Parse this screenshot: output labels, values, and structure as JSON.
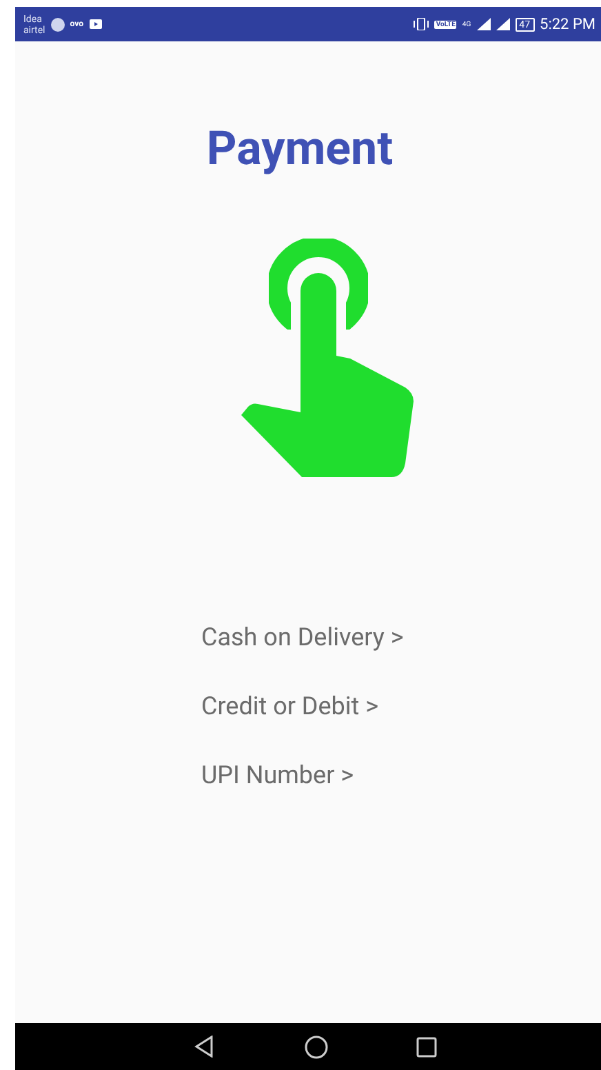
{
  "status_bar": {
    "carrier": [
      "Idea",
      "airtel"
    ],
    "app_label": "ovo",
    "network_badge": "VoLTE",
    "network_type": "4G",
    "battery": "47",
    "time": "5:22 PM"
  },
  "title": "Payment",
  "options": [
    {
      "label": "Cash on Delivery >"
    },
    {
      "label": "Credit or Debit >"
    },
    {
      "label": "UPI Number >"
    }
  ]
}
